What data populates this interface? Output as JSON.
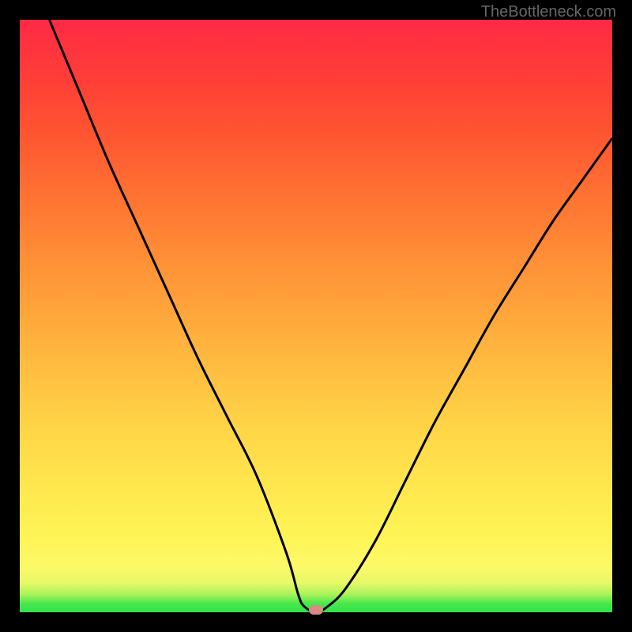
{
  "watermark": "TheBottleneck.com",
  "chart_data": {
    "type": "line",
    "title": "",
    "xlabel": "",
    "ylabel": "",
    "xlim": [
      0,
      100
    ],
    "ylim": [
      0,
      100
    ],
    "x": [
      5,
      10,
      15,
      20,
      25,
      30,
      35,
      40,
      45,
      47,
      48,
      50,
      52,
      55,
      60,
      65,
      70,
      75,
      80,
      85,
      90,
      95,
      100
    ],
    "values": [
      100,
      88,
      76,
      65,
      54,
      43,
      33,
      23,
      10,
      3,
      1,
      0,
      1,
      4,
      12,
      22,
      32,
      41,
      50,
      58,
      66,
      73,
      80
    ],
    "marker": {
      "x": 50,
      "y": 0
    },
    "annotations": []
  },
  "colors": {
    "curve": "#000000",
    "marker": "#d98a82",
    "background_top": "#ff2a44",
    "background_bottom": "#2fe04c",
    "frame": "#000000"
  }
}
